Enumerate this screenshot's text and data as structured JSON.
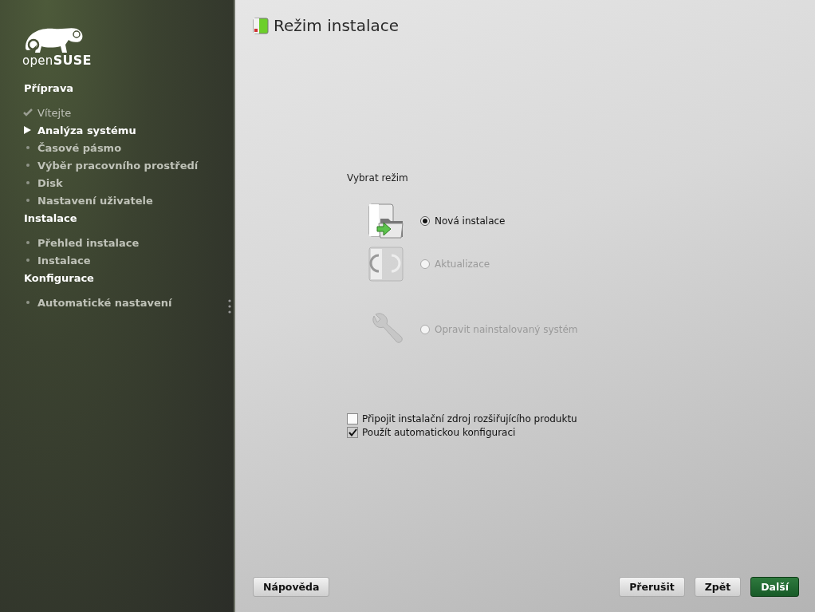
{
  "logo": {
    "text": "open**SUSE**"
  },
  "sidebar": {
    "sections": [
      {
        "title": "Příprava",
        "steps": [
          {
            "label": "Vítejte",
            "done": true,
            "current": false
          },
          {
            "label": "Analýza systému",
            "done": false,
            "current": true
          },
          {
            "label": "Časové pásmo",
            "done": false,
            "current": false
          },
          {
            "label": "Výběr pracovního prostředí",
            "done": false,
            "current": false
          },
          {
            "label": "Disk",
            "done": false,
            "current": false
          },
          {
            "label": "Nastavení uživatele",
            "done": false,
            "current": false
          }
        ]
      },
      {
        "title": "Instalace",
        "steps": [
          {
            "label": "Přehled instalace",
            "done": false,
            "current": false
          },
          {
            "label": "Instalace",
            "done": false,
            "current": false
          }
        ]
      },
      {
        "title": "Konfigurace",
        "steps": [
          {
            "label": "Automatické nastavení",
            "done": false,
            "current": false
          }
        ]
      }
    ]
  },
  "title": "Režim instalace",
  "mode_group": {
    "label": "Vybrat režim",
    "options": [
      {
        "label": "Nová instalace",
        "kind": "install",
        "selected": true,
        "disabled": false
      },
      {
        "label": "Aktualizace",
        "kind": "update",
        "selected": false,
        "disabled": true
      },
      {
        "label": "Opravit nainstalovaný systém",
        "kind": "repair",
        "selected": false,
        "disabled": true
      }
    ]
  },
  "checkboxes": [
    {
      "label": "Připojit instalační zdroj rozšiřujícího produktu",
      "checked": false
    },
    {
      "label": "Použít automatickou konfiguraci",
      "checked": true
    }
  ],
  "buttons": [
    {
      "label": "Nápověda",
      "kind": "help"
    },
    {
      "label": "Přerušit",
      "kind": "normal"
    },
    {
      "label": "Zpět",
      "kind": "normal"
    },
    {
      "label": "Další",
      "kind": "primary"
    }
  ]
}
